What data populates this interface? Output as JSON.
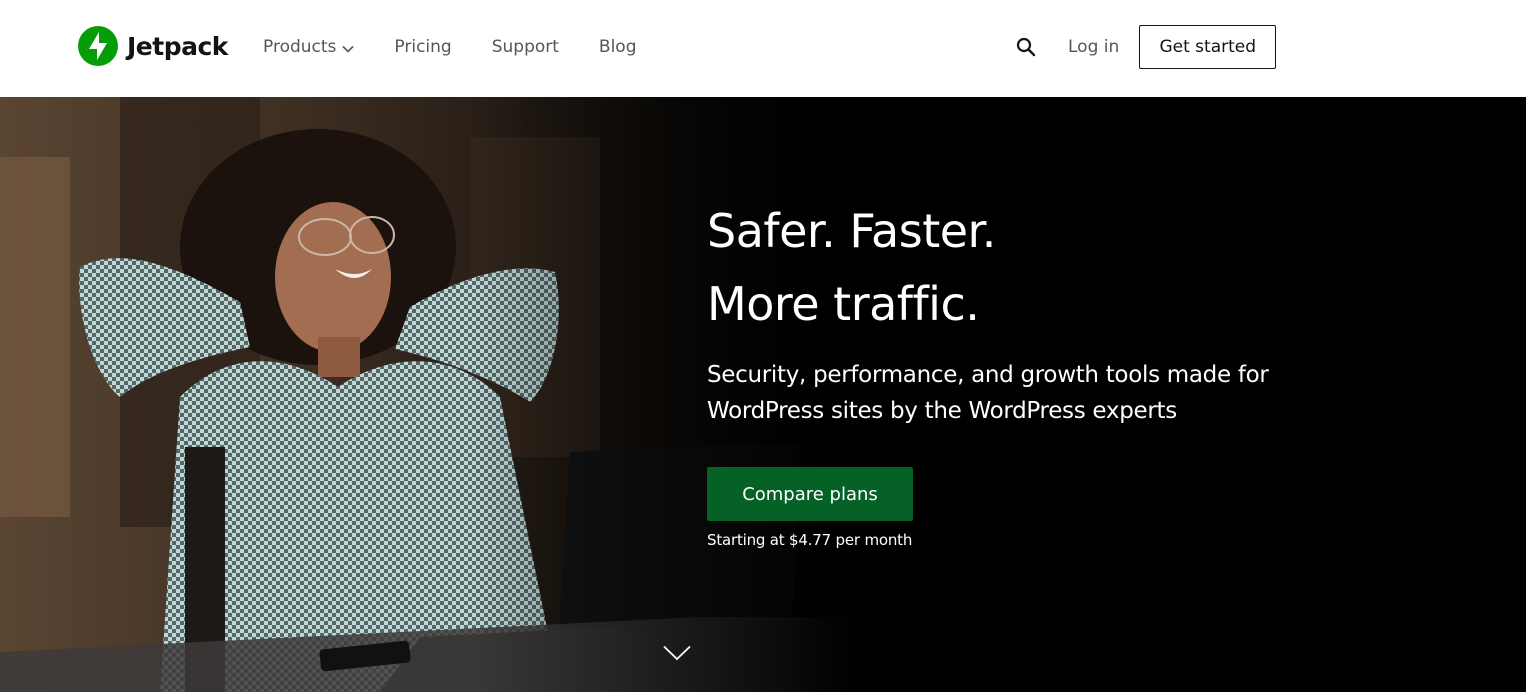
{
  "header": {
    "logo_text": "Jetpack",
    "nav": {
      "products": "Products",
      "pricing": "Pricing",
      "support": "Support",
      "blog": "Blog"
    },
    "login": "Log in",
    "get_started": "Get started"
  },
  "hero": {
    "title_line1": "Safer. Faster.",
    "title_line2": "More traffic.",
    "subtitle": "Security, performance, and growth tools made for WordPress sites by the WordPress experts",
    "cta_label": "Compare plans",
    "cta_note": "Starting at $4.77 per month"
  },
  "icons": {
    "logo": "jetpack-bolt-icon",
    "products_dropdown": "chevron-down-icon",
    "search": "search-icon",
    "scroll": "chevron-down-icon"
  },
  "colors": {
    "brand_green": "#069e08",
    "cta_green": "#066127",
    "text_dark": "#101517",
    "nav_gray": "#50575e",
    "hero_bg": "#000000"
  }
}
